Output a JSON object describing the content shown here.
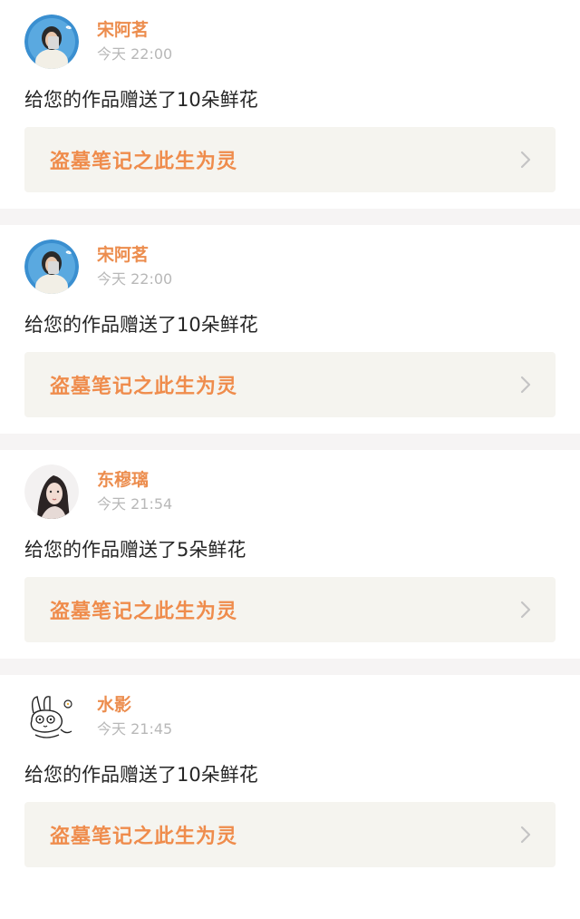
{
  "notifications": [
    {
      "username": "宋阿茗",
      "time": "今天 22:00",
      "message": "给您的作品赠送了10朵鲜花",
      "work_title": "盗墓笔记之此生为灵",
      "avatar": "avatar-girl-blue"
    },
    {
      "username": "宋阿茗",
      "time": "今天 22:00",
      "message": "给您的作品赠送了10朵鲜花",
      "work_title": "盗墓笔记之此生为灵",
      "avatar": "avatar-girl-blue"
    },
    {
      "username": "东穆璃",
      "time": "今天 21:54",
      "message": "给您的作品赠送了5朵鲜花",
      "work_title": "盗墓笔记之此生为灵",
      "avatar": "avatar-girl-portrait"
    },
    {
      "username": "水影",
      "time": "今天 21:45",
      "message": "给您的作品赠送了10朵鲜花",
      "work_title": "盗墓笔记之此生为灵",
      "avatar": "avatar-rabbit-doodle"
    }
  ],
  "colors": {
    "accent": "#ec8d4e",
    "link_bg": "#f5f4ef",
    "separator": "#f6f4f4",
    "time": "#b8b8b8"
  },
  "icons": {
    "chevron": "chevron-right-icon"
  }
}
